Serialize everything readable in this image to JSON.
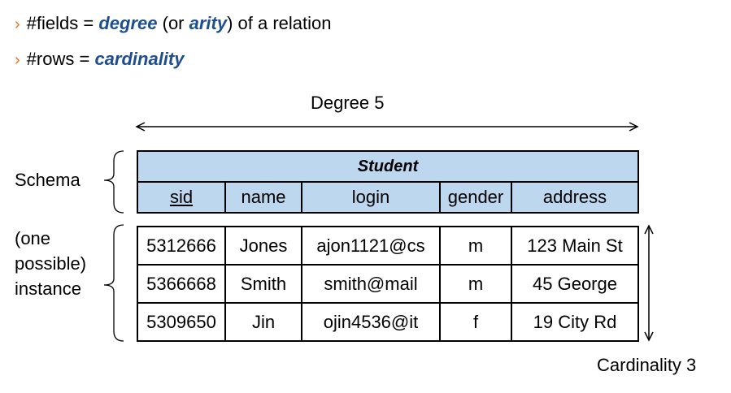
{
  "bullets": [
    {
      "marker": "›",
      "prefix": "#fields = ",
      "em1": "degree",
      "mid": " (or ",
      "em2": "arity",
      "suffix": ") of a relation"
    },
    {
      "marker": "›",
      "prefix": "#rows = ",
      "em1": "cardinality"
    }
  ],
  "degree_label": "Degree 5",
  "cardinality_label": "Cardinality 3",
  "schema_label": "Schema",
  "instance_label": [
    "(one",
    "possible)",
    "instance"
  ],
  "relation_name": "Student",
  "columns": [
    "sid",
    "name",
    "login",
    "gender",
    "address"
  ],
  "rows": [
    [
      "5312666",
      "Jones",
      "ajon1121@cs",
      "m",
      "123 Main St"
    ],
    [
      "5366668",
      "Smith",
      "smith@mail",
      "m",
      "45 George"
    ],
    [
      "5309650",
      "Jin",
      "ojin4536@it",
      "f",
      "19 City Rd"
    ]
  ],
  "colors": {
    "header_fill": "#bdd7ee",
    "emphasis": "#1f4e8c",
    "bullet_marker": "#e07a1f"
  }
}
